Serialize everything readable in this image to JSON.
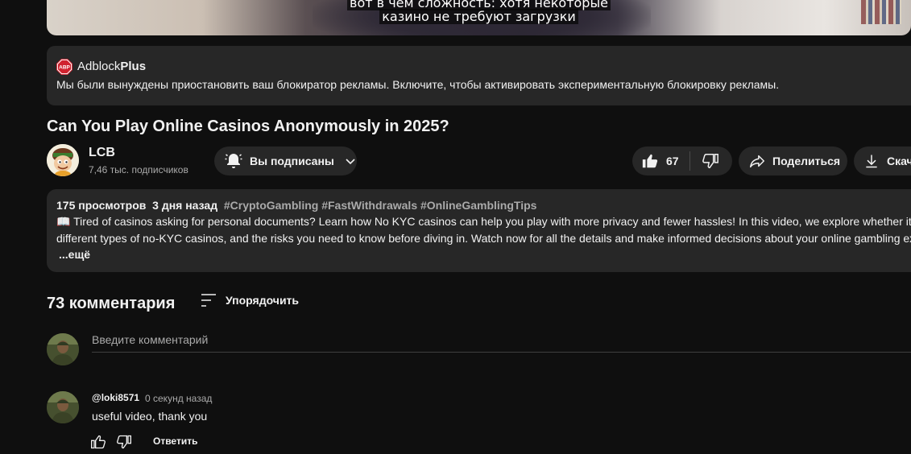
{
  "video": {
    "subtitle_line1": "вот в чем сложность: хотя некоторые",
    "subtitle_line2": "казино не требуют загрузки"
  },
  "adblock": {
    "brand_regular": "Adblock",
    "brand_bold": "Plus",
    "logo_text": "ABP",
    "message": "Мы были вынуждены приостановить ваш блокиратор рекламы. Включите, чтобы активировать экспериментальную блокировку рекламы.",
    "accent": "#d0222f"
  },
  "title": "Can You Play Online Casinos Anonymously in 2025?",
  "channel": {
    "name": "LCB",
    "subscribers": "7,46 тыс. подписчиков"
  },
  "actions": {
    "subscribed_label": "Вы подписаны",
    "like_count": "67",
    "share_label": "Поделиться",
    "download_label": "Скачать"
  },
  "description": {
    "views": "175 просмотров",
    "date": "3 дня назад",
    "hashtags": "#CryptoGambling #FastWithdrawals #OnlineGamblingTips",
    "line1": "📖 Tired of casinos asking for personal documents? Learn how No KYC casinos can help you play with more privacy and fewer hassles! In this video, we explore whether it's",
    "line2": "different types of no-KYC casinos, and the risks you need to know before diving in. Watch now for all the details and make informed decisions about your online gambling exp",
    "more": "...ещё"
  },
  "comments": {
    "count_label": "73 комментария",
    "sort_label": "Упорядочить",
    "input_placeholder": "Введите комментарий",
    "items": [
      {
        "author": "@loki8571",
        "time": "0 секунд назад",
        "text": "useful video, thank you",
        "reply_label": "Ответить"
      }
    ]
  },
  "icons": {
    "abp": "adblock-plus-logo-icon",
    "bell": "bell-icon",
    "chevron": "chevron-down-icon",
    "like": "thumbs-up-icon",
    "dislike": "thumbs-down-icon",
    "share": "share-arrow-icon",
    "download": "download-icon",
    "sort": "sort-lines-icon"
  }
}
